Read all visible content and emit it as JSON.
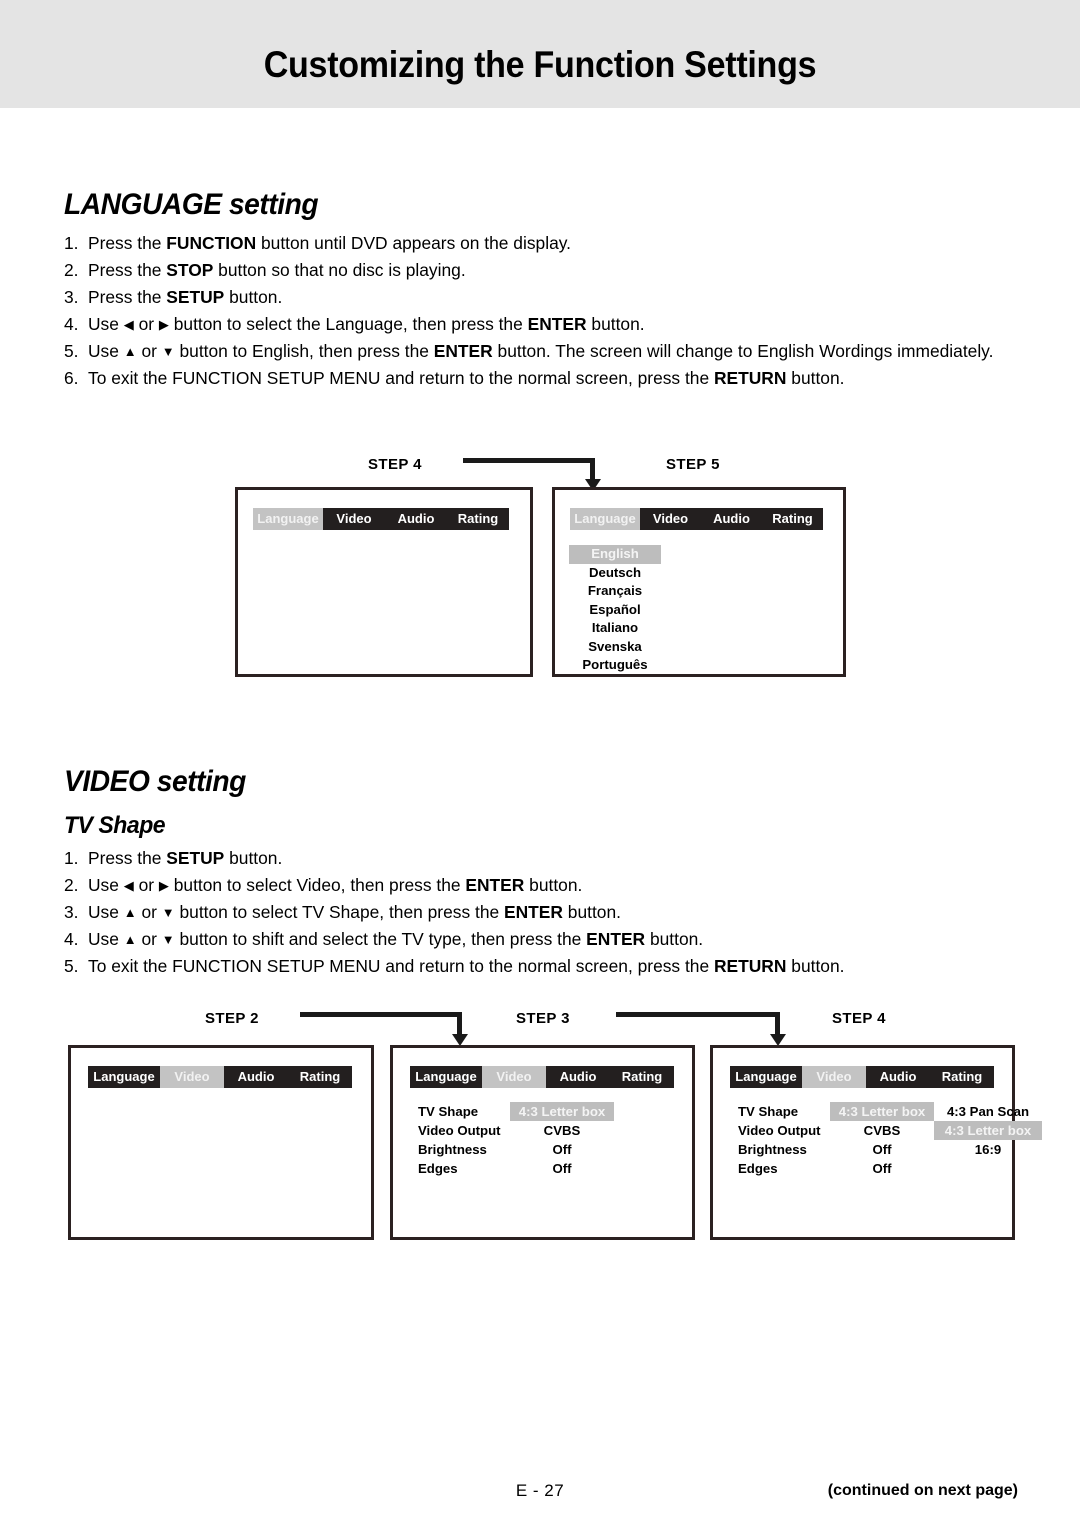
{
  "header": {
    "title": "Customizing the Function Settings",
    "band_color": "#e4e4e4"
  },
  "language_section": {
    "heading": "LANGUAGE setting",
    "steps": [
      {
        "num": "1.",
        "parts": [
          {
            "t": "Press the ",
            "b": false
          },
          {
            "t": "FUNCTION",
            "b": true
          },
          {
            "t": " button until DVD appears on the display.",
            "b": false
          }
        ]
      },
      {
        "num": "2.",
        "parts": [
          {
            "t": "Press the ",
            "b": false
          },
          {
            "t": "STOP",
            "b": true
          },
          {
            "t": " button so that no disc is playing.",
            "b": false
          }
        ]
      },
      {
        "num": "3.",
        "parts": [
          {
            "t": "Press the ",
            "b": false
          },
          {
            "t": "SETUP",
            "b": true
          },
          {
            "t": " button.",
            "b": false
          }
        ]
      },
      {
        "num": "4.",
        "parts": [
          {
            "t": "Use ",
            "b": false
          },
          {
            "t": "◀",
            "b": false,
            "glyph": true
          },
          {
            "t": " or ",
            "b": false
          },
          {
            "t": "▶",
            "b": false,
            "glyph": true
          },
          {
            "t": " button to select the Language, then press the ",
            "b": false
          },
          {
            "t": "ENTER",
            "b": true
          },
          {
            "t": " button.",
            "b": false
          }
        ]
      },
      {
        "num": "5.",
        "justify": true,
        "parts": [
          {
            "t": "Use ",
            "b": false
          },
          {
            "t": "▲",
            "b": false,
            "glyph": true
          },
          {
            "t": " or ",
            "b": false
          },
          {
            "t": "▼",
            "b": false,
            "glyph": true
          },
          {
            "t": " button to English, then press the ",
            "b": false
          },
          {
            "t": "ENTER",
            "b": true
          },
          {
            "t": " button. The screen will change to English Wordings immediately.",
            "b": false
          }
        ]
      },
      {
        "num": "6.",
        "parts": [
          {
            "t": "To exit the FUNCTION SETUP MENU and return to the normal screen, press the ",
            "b": false
          },
          {
            "t": "RETURN",
            "b": true
          },
          {
            "t": " button.",
            "b": false
          }
        ]
      }
    ],
    "diagram": {
      "step4_label": "STEP  4",
      "step5_label": "STEP  5",
      "menu_tabs": [
        "Language",
        "Video",
        "Audio",
        "Rating"
      ],
      "selected_tab": "Language",
      "languages": [
        "English",
        "Deutsch",
        "Français",
        "Español",
        "Italiano",
        "Svenska",
        "Português"
      ],
      "selected_language": "English"
    }
  },
  "video_section": {
    "heading": "VIDEO setting",
    "subheading": "TV Shape",
    "steps": [
      {
        "num": "1.",
        "parts": [
          {
            "t": "Press the ",
            "b": false
          },
          {
            "t": "SETUP",
            "b": true
          },
          {
            "t": " button.",
            "b": false
          }
        ]
      },
      {
        "num": "2.",
        "parts": [
          {
            "t": "Use ",
            "b": false
          },
          {
            "t": "◀",
            "b": false,
            "glyph": true
          },
          {
            "t": " or ",
            "b": false
          },
          {
            "t": "▶",
            "b": false,
            "glyph": true
          },
          {
            "t": " button to select Video, then press the ",
            "b": false
          },
          {
            "t": "ENTER",
            "b": true
          },
          {
            "t": " button.",
            "b": false
          }
        ]
      },
      {
        "num": "3.",
        "parts": [
          {
            "t": "Use ",
            "b": false
          },
          {
            "t": "▲",
            "b": false,
            "glyph": true
          },
          {
            "t": " or ",
            "b": false
          },
          {
            "t": "▼",
            "b": false,
            "glyph": true
          },
          {
            "t": " button to select TV Shape, then press the ",
            "b": false
          },
          {
            "t": "ENTER",
            "b": true
          },
          {
            "t": " button.",
            "b": false
          }
        ]
      },
      {
        "num": "4.",
        "parts": [
          {
            "t": "Use ",
            "b": false
          },
          {
            "t": "▲",
            "b": false,
            "glyph": true
          },
          {
            "t": " or ",
            "b": false
          },
          {
            "t": "▼",
            "b": false,
            "glyph": true
          },
          {
            "t": " button to shift and select the TV type, then press the ",
            "b": false
          },
          {
            "t": "ENTER",
            "b": true
          },
          {
            "t": " button.",
            "b": false
          }
        ]
      },
      {
        "num": "5.",
        "parts": [
          {
            "t": "To exit the FUNCTION SETUP MENU and return to the normal screen, press the ",
            "b": false
          },
          {
            "t": "RETURN",
            "b": true
          },
          {
            "t": " button.",
            "b": false
          }
        ]
      }
    ],
    "diagram": {
      "step2_label": "STEP  2",
      "step3_label": "STEP  3",
      "step4_label": "STEP  4",
      "menu_tabs": [
        "Language",
        "Video",
        "Audio",
        "Rating"
      ],
      "step2_selected_tab": "Video",
      "step3_selected_tab": "Video",
      "step4_selected_tab": "Video",
      "settings_rows": [
        {
          "label": "TV Shape",
          "value": "4:3 Letter box",
          "value_selected": true
        },
        {
          "label": "Video Output",
          "value": "CVBS",
          "value_selected": false
        },
        {
          "label": "Brightness",
          "value": "Off",
          "value_selected": false
        },
        {
          "label": "Edges",
          "value": "Off",
          "value_selected": false
        }
      ],
      "tv_type_options": [
        {
          "label": "4:3 Pan Scan",
          "selected": false
        },
        {
          "label": "4:3 Letter box",
          "selected": true
        },
        {
          "label": "16:9",
          "selected": false
        }
      ]
    }
  },
  "footer": {
    "page_number": "E - 27",
    "continued": "(continued on next page)"
  },
  "colors": {
    "menu_bg": "#231f1f",
    "menu_selected_bg": "#c3c3c3",
    "highlight_bg": "#bdbdbd",
    "box_border": "#2b2121",
    "connector": "#1a1a1a"
  }
}
